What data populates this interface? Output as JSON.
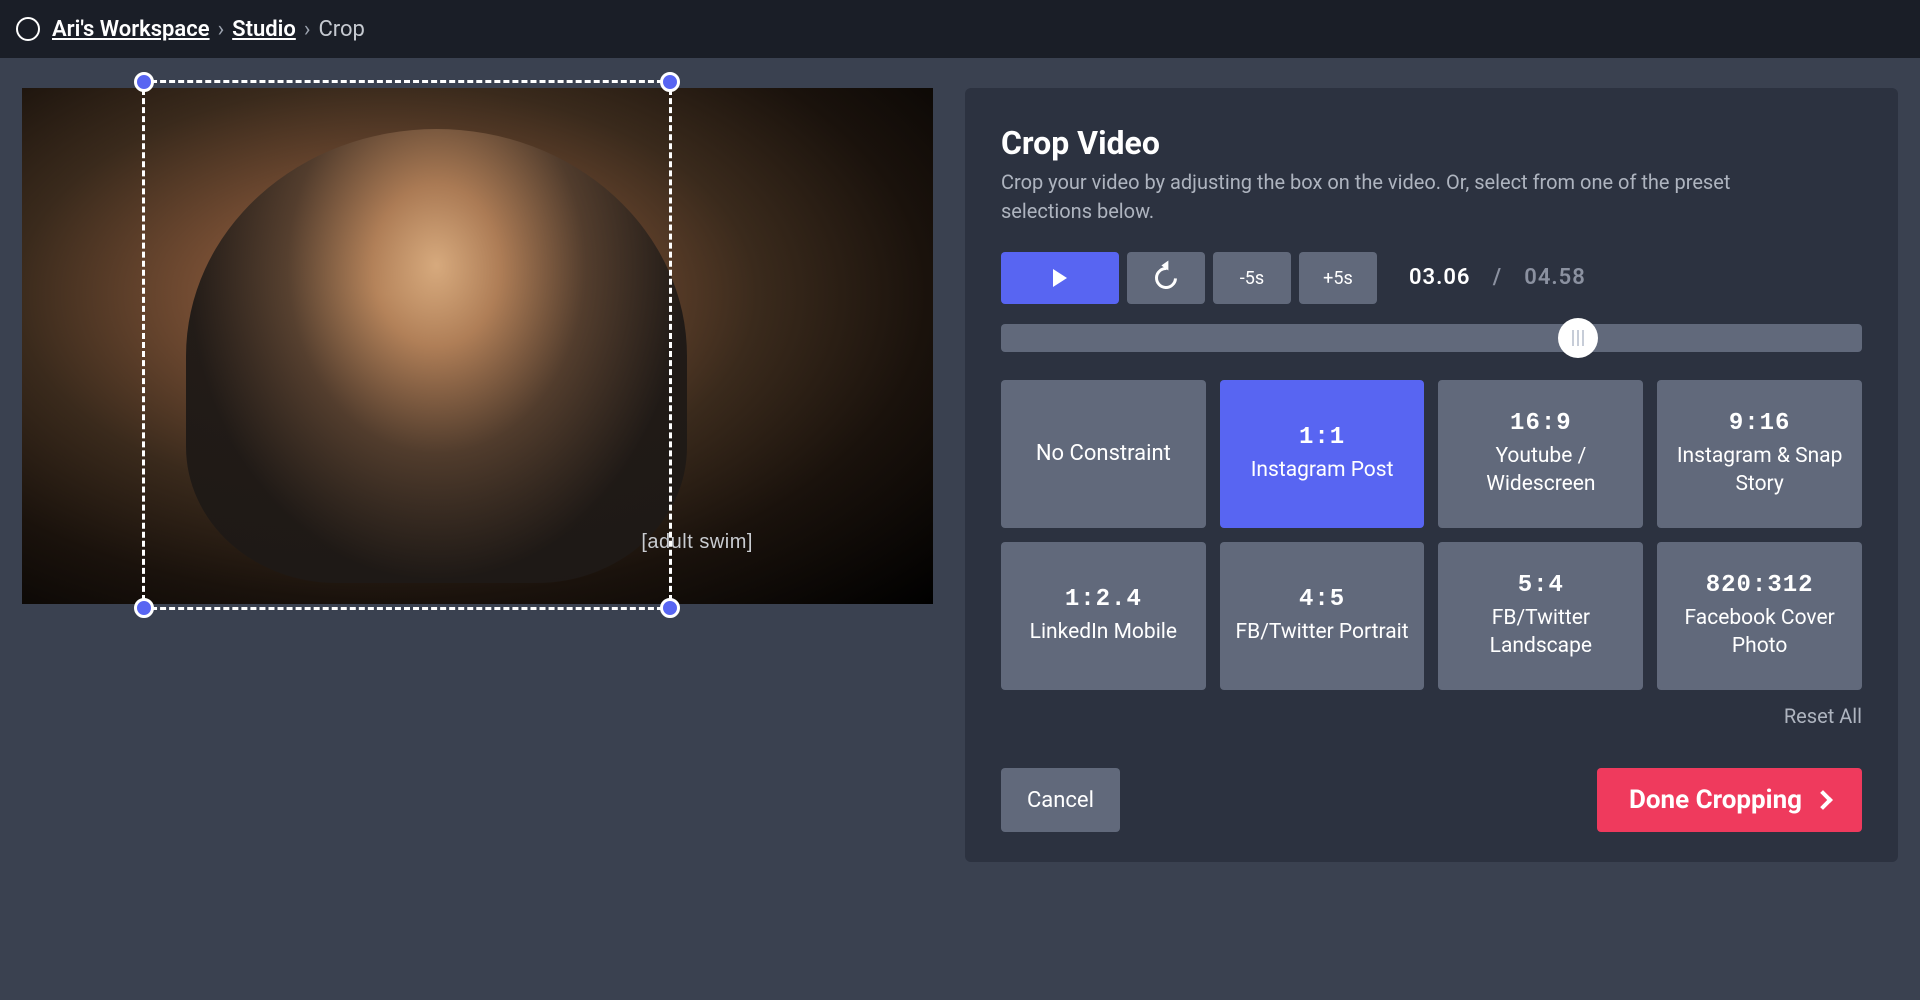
{
  "breadcrumb": {
    "workspace": "Ari's Workspace",
    "studio": "Studio",
    "current": "Crop"
  },
  "video": {
    "watermark": "[adult swim]"
  },
  "panel": {
    "title": "Crop Video",
    "description": "Crop your video by adjusting the box on the video. Or, select from one of the preset selections below."
  },
  "controls": {
    "back5": "-5s",
    "fwd5": "+5s",
    "current_time": "03.06",
    "total_time": "04.58",
    "progress_percent": 67
  },
  "presets": [
    {
      "ratio": "",
      "label": "No Constraint",
      "selected": false
    },
    {
      "ratio": "1:1",
      "label": "Instagram Post",
      "selected": true
    },
    {
      "ratio": "16:9",
      "label": "Youtube / Widescreen",
      "selected": false
    },
    {
      "ratio": "9:16",
      "label": "Instagram & Snap Story",
      "selected": false
    },
    {
      "ratio": "1:2.4",
      "label": "LinkedIn Mobile",
      "selected": false
    },
    {
      "ratio": "4:5",
      "label": "FB/Twitter Portrait",
      "selected": false
    },
    {
      "ratio": "5:4",
      "label": "FB/Twitter Landscape",
      "selected": false
    },
    {
      "ratio": "820:312",
      "label": "Facebook Cover Photo",
      "selected": false
    }
  ],
  "reset_label": "Reset All",
  "actions": {
    "cancel": "Cancel",
    "done": "Done Cropping"
  }
}
